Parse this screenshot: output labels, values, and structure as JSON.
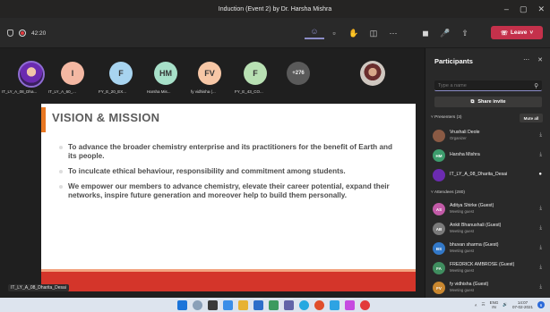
{
  "window": {
    "title": "Induction (Event 2) by Dr. Harsha Mishra",
    "controls": [
      "–",
      "▢",
      "✕"
    ]
  },
  "toolbar": {
    "timer": "42:20",
    "leave_label": "Leave",
    "icons": [
      "participants-icon",
      "chat-icon",
      "raise-hand-icon",
      "rooms-icon",
      "more-icon",
      "camera-off-icon",
      "mic-off-icon",
      "share-icon"
    ]
  },
  "strip": {
    "participants": [
      {
        "initials": "",
        "color": "#6b2bb0",
        "label": "IT_LY_A_08_Dha..."
      },
      {
        "initials": "I",
        "color": "#f4b8a3",
        "label": "IT_LY_A_60_... "
      },
      {
        "initials": "F",
        "color": "#a8d4f0",
        "label": "FY_E_20_EX..."
      },
      {
        "initials": "HM",
        "color": "#a7e0c9",
        "label": "Harsha Mis..."
      },
      {
        "initials": "FV",
        "color": "#f7c7a6",
        "label": "fy vidhisha (..."
      },
      {
        "initials": "F",
        "color": "#b8e0b3",
        "label": "FY_E_43_CO..."
      }
    ],
    "overflow": "+276"
  },
  "slide": {
    "title": "VISION & MISSION",
    "bullets": [
      "To advance the broader chemistry enterprise and its practitioners for the benefit of Earth and its people.",
      "To inculcate ethical behaviour, responsibility and commitment among students.",
      "We empower our members to advance chemistry, elevate their career potential, expand their networks, inspire future generation and moreover help to build them personally."
    ]
  },
  "video_name": "IT_LY_A_08_Dharita_Desai",
  "panel": {
    "title": "Participants",
    "search_placeholder": "Type a name",
    "share_invite": "Share invite",
    "presenters_header": "Presenters (3)",
    "mute_all": "Mute all",
    "attendees_header": "Attendees (280)",
    "presenters": [
      {
        "name": "Vrushali Deole",
        "role": "Organizer",
        "initials": "",
        "color": "#8a5a44"
      },
      {
        "name": "Harsha Mishra",
        "role": "",
        "initials": "HM",
        "color": "#3d9c6d"
      },
      {
        "name": "IT_LY_A_08_Dharita_Desai",
        "role": "",
        "initials": "",
        "color": "#6b2bb0"
      }
    ],
    "attendees": [
      {
        "name": "Aditya Shirke (Guest)",
        "role": "Meeting guest",
        "initials": "AS",
        "color": "#c25aa7"
      },
      {
        "name": "Ankit Bhanushali (Guest)",
        "role": "Meeting guest",
        "initials": "AB",
        "color": "#7a7a7a"
      },
      {
        "name": "bhuvan sharma (Guest)",
        "role": "Meeting guest",
        "initials": "BS",
        "color": "#3278c8"
      },
      {
        "name": "FREDRICK AMBROSE (Guest)",
        "role": "Meeting guest",
        "initials": "FA",
        "color": "#3f8d5f"
      },
      {
        "name": "fy vidhisha (Guest)",
        "role": "Meeting guest",
        "initials": "FV",
        "color": "#c9872f"
      }
    ]
  },
  "taskbar": {
    "lang": "ENG",
    "lang2": "IN",
    "time": "14:07",
    "date": "07-02-2021",
    "notifications": "6"
  }
}
